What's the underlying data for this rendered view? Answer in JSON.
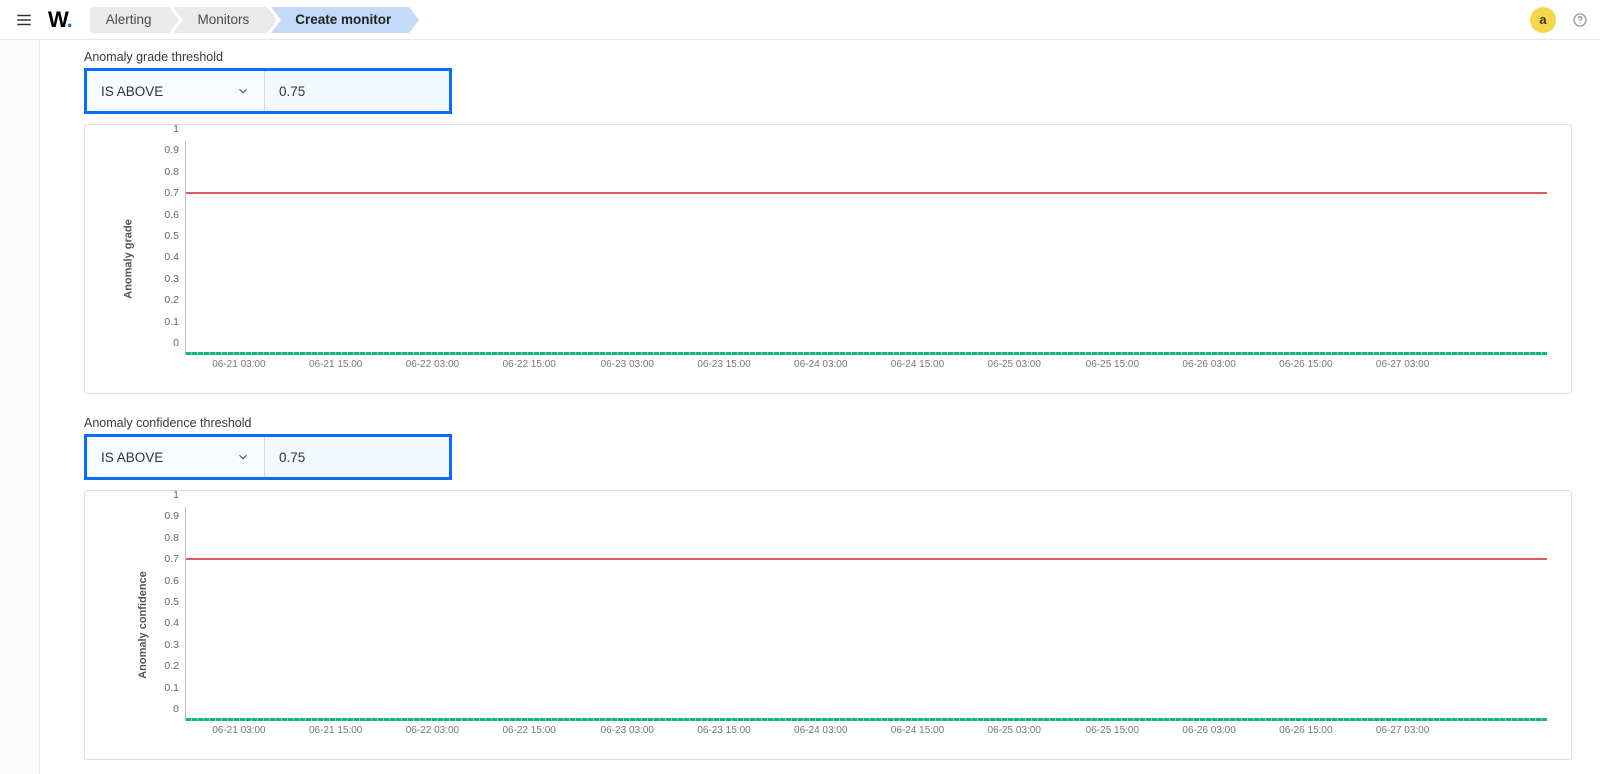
{
  "topbar": {
    "logo_text": "W",
    "logo_dot": ".",
    "avatar_letter": "a"
  },
  "breadcrumbs": [
    "Alerting",
    "Monitors",
    "Create monitor"
  ],
  "x_ticks": [
    "06-21 03:00",
    "06-21 15:00",
    "06-22 03:00",
    "06-22 15:00",
    "06-23 03:00",
    "06-23 15:00",
    "06-24 03:00",
    "06-24 15:00",
    "06-25 03:00",
    "06-25 15:00",
    "06-26 03:00",
    "06-26 15:00",
    "06-27 03:00"
  ],
  "y_ticks": [
    "0",
    "0.1",
    "0.2",
    "0.3",
    "0.4",
    "0.5",
    "0.6",
    "0.7",
    "0.8",
    "0.9",
    "1"
  ],
  "grade": {
    "label": "Anomaly grade threshold",
    "operator": "IS ABOVE",
    "value": "0.75",
    "ylabel": "Anomaly grade"
  },
  "confidence": {
    "label": "Anomaly confidence threshold",
    "operator": "IS ABOVE",
    "value": "0.75",
    "ylabel": "Anomaly confidence"
  },
  "chart_data": [
    {
      "type": "line",
      "title": "Anomaly grade",
      "xlabel": "",
      "ylabel": "Anomaly grade",
      "ylim": [
        0,
        1
      ],
      "x": [
        "06-21 03:00",
        "06-21 15:00",
        "06-22 03:00",
        "06-22 15:00",
        "06-23 03:00",
        "06-23 15:00",
        "06-24 03:00",
        "06-24 15:00",
        "06-25 03:00",
        "06-25 15:00",
        "06-26 03:00",
        "06-26 15:00",
        "06-27 03:00"
      ],
      "series": [
        {
          "name": "Anomaly grade",
          "values": [
            0,
            0,
            0,
            0,
            0,
            0,
            0,
            0,
            0,
            0,
            0,
            0,
            0
          ],
          "color": "#15b585"
        },
        {
          "name": "Threshold",
          "values": [
            0.75,
            0.75,
            0.75,
            0.75,
            0.75,
            0.75,
            0.75,
            0.75,
            0.75,
            0.75,
            0.75,
            0.75,
            0.75
          ],
          "color": "#e05a5a"
        }
      ]
    },
    {
      "type": "line",
      "title": "Anomaly confidence",
      "xlabel": "",
      "ylabel": "Anomaly confidence",
      "ylim": [
        0,
        1
      ],
      "x": [
        "06-21 03:00",
        "06-21 15:00",
        "06-22 03:00",
        "06-22 15:00",
        "06-23 03:00",
        "06-23 15:00",
        "06-24 03:00",
        "06-24 15:00",
        "06-25 03:00",
        "06-25 15:00",
        "06-26 03:00",
        "06-26 15:00",
        "06-27 03:00"
      ],
      "series": [
        {
          "name": "Anomaly confidence",
          "values": [
            0,
            0,
            0,
            0,
            0,
            0,
            0,
            0,
            0,
            0,
            0,
            0,
            0
          ],
          "color": "#15b585"
        },
        {
          "name": "Threshold",
          "values": [
            0.75,
            0.75,
            0.75,
            0.75,
            0.75,
            0.75,
            0.75,
            0.75,
            0.75,
            0.75,
            0.75,
            0.75,
            0.75
          ],
          "color": "#e05a5a"
        }
      ]
    }
  ]
}
